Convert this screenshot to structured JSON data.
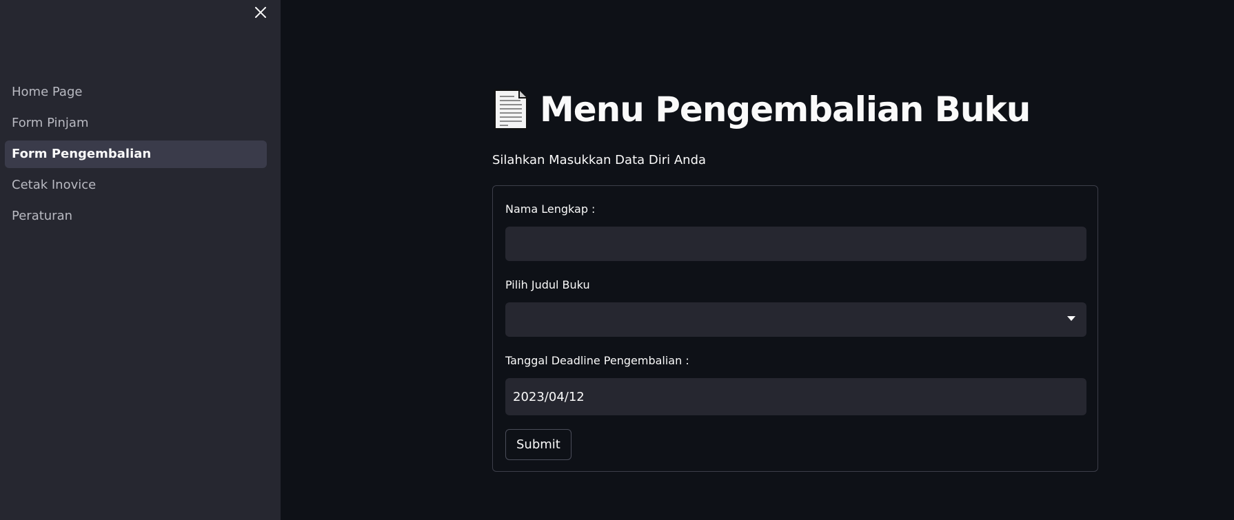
{
  "sidebar": {
    "close_icon": "close-icon",
    "items": [
      {
        "label": "Home Page",
        "active": false
      },
      {
        "label": "Form Pinjam",
        "active": false
      },
      {
        "label": "Form Pengembalian",
        "active": true
      },
      {
        "label": "Cetak Inovice",
        "active": false
      },
      {
        "label": "Peraturan",
        "active": false
      }
    ]
  },
  "main": {
    "title_icon": "page-facing-up-icon",
    "title": "Menu Pengembalian Buku",
    "subtitle": "Silahkan Masukkan Data Diri Anda",
    "form": {
      "name_label": "Nama Lengkap :",
      "name_value": "",
      "book_label": "Pilih Judul Buku",
      "book_value": "",
      "deadline_label": "Tanggal Deadline Pengembalian :",
      "deadline_value": "2023/04/12",
      "submit_label": "Submit"
    }
  },
  "colors": {
    "background": "#0e1117",
    "sidebar": "#262730",
    "active_item": "#3a3b4a",
    "input": "#262730",
    "text": "#fafafa"
  }
}
